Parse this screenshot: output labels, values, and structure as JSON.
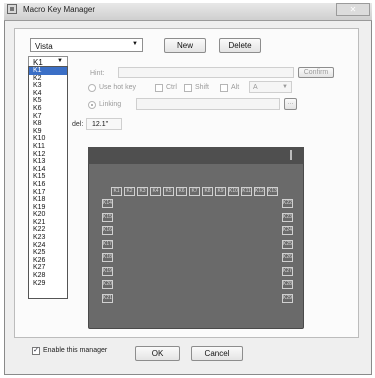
{
  "window": {
    "title": "Macro Key Manager",
    "close_glyph": "✕"
  },
  "profile": {
    "selected": "Vista",
    "options_arrow": "▼"
  },
  "toolbar": {
    "new_label": "New",
    "delete_label": "Delete"
  },
  "key_select": {
    "selected": "K1",
    "arrow": "▼"
  },
  "form": {
    "hint_label": "Hint:",
    "confirm_label": "Confirm",
    "use_hotkey_label": "Use hot key",
    "ctrl_label": "Ctrl",
    "shift_label": "Shift",
    "alt_label": "Alt",
    "key_combo_value": "A",
    "linking_label": "Linking",
    "browse_label": "..."
  },
  "model": {
    "label": "del:",
    "value": "12.1\""
  },
  "key_list": [
    "K1",
    "K2",
    "K3",
    "K4",
    "K5",
    "K6",
    "K7",
    "K8",
    "K9",
    "K10",
    "K11",
    "K12",
    "K13",
    "K14",
    "K15",
    "K16",
    "K17",
    "K18",
    "K19",
    "K20",
    "K21",
    "K22",
    "K23",
    "K24",
    "K25",
    "K26",
    "K27",
    "K28",
    "K29"
  ],
  "device": {
    "top_keys": [
      "K1",
      "K2",
      "K3",
      "K4",
      "K5",
      "K6",
      "K7",
      "K8",
      "K9",
      "K10",
      "K11",
      "K12",
      "K13"
    ],
    "left_keys": [
      "K14",
      "K15",
      "K16",
      "K17",
      "K18",
      "K19",
      "K20",
      "K21"
    ],
    "right_keys": [
      "K22",
      "K23",
      "K24",
      "K25",
      "K26",
      "K27",
      "K28",
      "K29"
    ]
  },
  "footer": {
    "enable_label": "Enable this manager",
    "enable_checked": true,
    "check_glyph": "✓",
    "ok_label": "OK",
    "cancel_label": "Cancel"
  }
}
